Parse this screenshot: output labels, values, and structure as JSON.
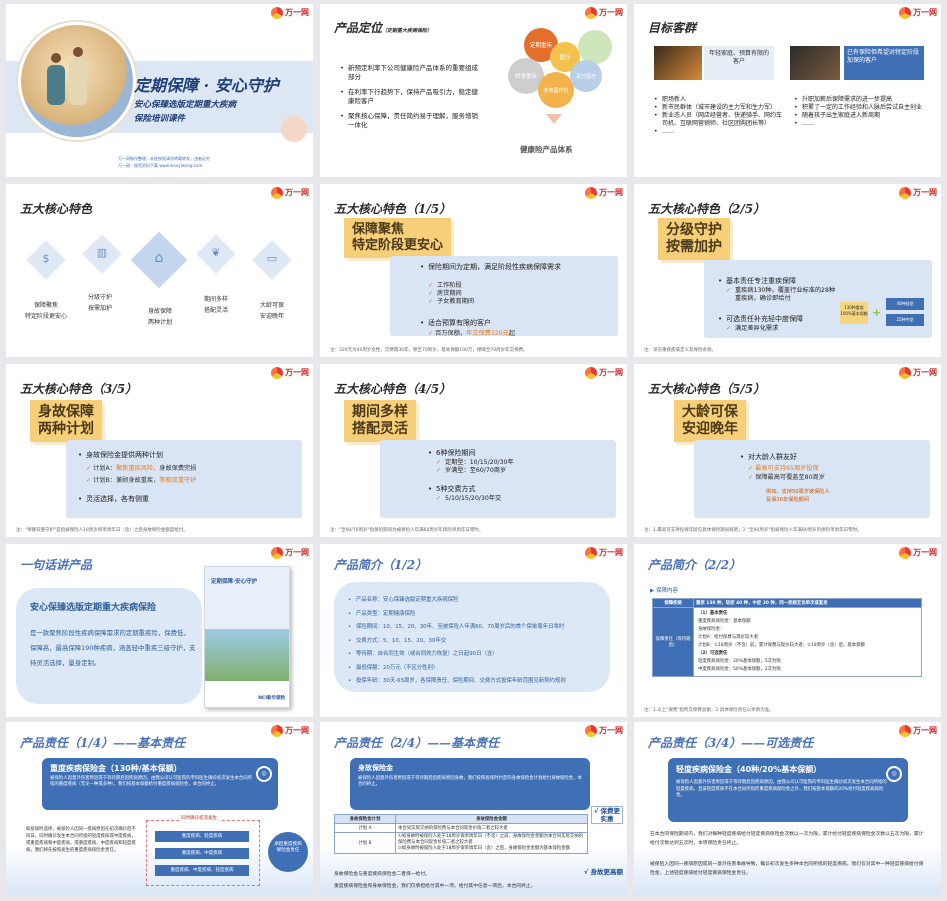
{
  "brand": {
    "logo_text": "万一网",
    "logo_sub": "WANYI.NET"
  },
  "slides": [
    {
      "id": "s1",
      "title": "定期保障 · 安心守护",
      "subtitle_line1": "安心保臻选版定期重大疾病",
      "subtitle_line2": "保险培训课件",
      "footer1": "万一网制作整理，未经授权请勿转载转发，违者必究",
      "footer2": "万一网：保险资料下载 www.wanyiwang.com"
    },
    {
      "id": "s2",
      "title": "产品定位",
      "title_note": "（定期重大疾病保险）",
      "bullets": [
        "新预定利率下公司健康险产品体系的重要组成部分",
        "在利率下行趋势下，保持产品吸引力，稳定健康险客户",
        "聚焦核心保障，责任简约易于理解，服务增销一体化"
      ],
      "circles": [
        "定期重疾",
        "终身重疾",
        "医疗",
        "重疾+",
        "各类医疗险",
        "百万医疗"
      ],
      "caption": "健康险产品体系"
    },
    {
      "id": "s3",
      "title": "目标客群",
      "card1": "年轻家庭、预算有限的客户",
      "card2": "已有保险但希望对特定阶段加保的客户",
      "col1": [
        "职场新人",
        "新市民群体（城市建设的主力军和生力军）",
        "新业态人员（网店经营者、快递骑手、网约车司机、互联网营销师、社区团购团长等）",
        "……"
      ],
      "col2": [
        "升职加薪后保障需求的进一步提高",
        "积累了一定的工作经验和人脉后尝试自主创业",
        "随着孩子出生家庭进入新周期",
        "……"
      ]
    },
    {
      "id": "s4",
      "title": "五大核心特色",
      "features": [
        "保障聚焦\n特定阶段更安心",
        "分级守护\n按需加护",
        "身故保障\n两种计划",
        "期间多样\n搭配灵活",
        "大龄可保\n安迎晚年"
      ]
    },
    {
      "id": "s5",
      "title": "五大核心特色（1/5）",
      "badge": "保障聚焦\n特定阶段更安心",
      "b1": "保险期间为定期，满足阶段性疾病保障需求",
      "b1_sub": [
        "工作阶段",
        "房贷期间",
        "子女教育期间"
      ],
      "b2": "适合预算有限的客户",
      "b2_sub_prefix": "百万保额，",
      "b2_sub_hl": "年交保费320元",
      "b2_sub_suffix": "起",
      "foot": "注：320元为40周岁女性，交费期30年，保至70周岁，基本保额100万，保障至70周岁年交保费。"
    },
    {
      "id": "s6",
      "title": "五大核心特色（2/5）",
      "badge": "分级守护\n按需加护",
      "b1": "基本责任专注重疾保障",
      "b1_sub": [
        "重疾病130种，覆盖行业标准的28种重疾病，确诊即给付"
      ],
      "b2": "可选责任补充轻中度保障",
      "b2_sub": [
        "满足差异化需求"
      ],
      "box1": "130种重疾",
      "box2": "100%基本保额",
      "box3": "40种轻症",
      "box4": "25种中症",
      "foot": "注：详见重疾疾病定义及保险条款。"
    },
    {
      "id": "s7",
      "title": "五大核心特色（3/5）",
      "badge": "身故保障\n两种计划",
      "b1": "身故保险金提供两种计划",
      "b1_sub_a_prefix": "计划A：",
      "b1_sub_a_hl": "聚焦重疾风险，",
      "b1_sub_a_suffix": "身故保费完损",
      "b1_sub_b_prefix": "计划B：兼顾身故重疾，",
      "b1_sub_b_hl": "等额双重守护",
      "b2": "灵活选择，各有侧重",
      "foot": "注：\"保额双重守护\"是指被保险人18周岁保单周年日（含）之后身故保险金额度给付。"
    },
    {
      "id": "s8",
      "title": "五大核心特色（4/5）",
      "badge": "期间多样\n搭配灵活",
      "b1": "6种保险期间",
      "b1_sub": [
        "定期型：10/15/20/30年",
        "岁满型：至60/70周岁"
      ],
      "b2": "5种交费方式",
      "b2_sub": [
        "5/10/15/20/30年交"
      ],
      "foot": "注：\"至60/70周岁\"指保险期间为被保险人年满60周岁年保险单周年日零时。"
    },
    {
      "id": "s9",
      "title": "五大核心特色（5/5）",
      "badge": "大龄可保\n安迎晚年",
      "b1": "对大龄人群友好",
      "b1_sub": [
        "最高可支持65周岁投保",
        "保障最高可覆盖至80周岁"
      ],
      "note1": "例如，支持50周岁被保险人",
      "note2": "投保30年保险期间",
      "foot": "注：1.最高可支持投保年龄见具体保险期间规则；2.\"至80周岁\"指被保险人年满80周岁的保险单周年日零时。"
    },
    {
      "id": "s10",
      "title": "一句话讲产品",
      "heading": "安心保臻选版定期重大疾病保险",
      "body": "是一款聚焦阶段性疾病保障需求的定期重疾险，保费低，保障高，最高保障190种疾病，涵盖轻中重疾三级守护，支持灵活选择，量身定制。",
      "brochure_title": "定期保障·安心守护",
      "brochure_brand": "NCI新华保险"
    },
    {
      "id": "s11",
      "title": "产品简介（1/2）",
      "items": [
        "产品名称：安心保臻选版定期重大疾病保险",
        "产品类型：定期健康保险",
        "保险期间：10、15、20、30年、至被保险人年满60、70周岁后的首个保单周年日零时",
        "交费方式：5、10、15、20、30年交",
        "等待期：自合同生效（或合同效力恢复）之日起90日（含）",
        "最低保额：20万元（不区分性别）",
        "投保年龄：30天-65周岁，各保障责任、保险期间、交费方式投保年龄范围见新契约规则"
      ]
    },
    {
      "id": "s12",
      "title": "产品简介（2/2）",
      "section": "保障内容",
      "header_label": "保障疾病",
      "header_value": "重疾 130 种，轻症 40 种，中症 20 种，同一疾病无论单次或复发",
      "left_label": "保障责任（等待期后）",
      "rows": [
        "（1）基本责任",
        "重度疾病保险金：基本保额",
        "身故保险金：",
        "计划A：给付保费与现价较大者",
        "计划B：①18周岁（不含）前，累计保费与现价较大者；②18周岁（含）后，基本保额",
        "（2）可选责任",
        "轻度疾病保险金：20%基本保额，5次为限",
        "中度疾病保险金：50%基本保额，2次为限"
      ],
      "foot": "注：1.以上\"保费\"指所交保费总额；2.具体保险责任以条款为准。"
    },
    {
      "id": "s13",
      "title": "产品责任（1/4）——基本责任",
      "box_title": "重度疾病保险金（130种/基本保额）",
      "box_text": "被保险人因意外伤害原因或于等待期后因疾病原因，由我公司认可医院的专科医生确诊初次发生本合同所指的重度疾病（无论一种或多种），我们按基本保额给付重度疾病保险金，本合同终止。",
      "left_text": "如投保时选择，被保险人因同一疾病原因在初次确诊后不同日，同时确诊发生本合同所指的轻度疾病或中度疾病，或重度疾病和中度疾病，或重度疾病、中度疾病和轻度疾病，我们将先按照发生的重度疾病保险金责任。",
      "flow_top": "同时确诊初次发生",
      "flow_items": [
        "重度疾病、轻度疾病",
        "重度疾病、中度疾病",
        "重度疾病、中度疾病、轻度疾病"
      ],
      "circle": "承担重度疾病保险金责任"
    },
    {
      "id": "s14",
      "title": "产品责任（2/4）——基本责任",
      "box_title": "身故保险金",
      "box_text": "被保险人因意外伤害原因或于等待期后因疾病原因身故，我们按照投保时约定的身故保险金计划给付身故保险金，本合同终止。",
      "tbl_head1": "身故保险金计划",
      "tbl_head2": "身故保险金金额",
      "row_a_label": "计划 A",
      "row_a_text": "本合同实际交纳的保险费与本合同现金价值二者之较大者",
      "row_b_label": "计划 B",
      "row_b_text1": "①如身故时被保险人处于18周岁保单周年日（不含）之前，身故保险金金额为本合同实际交纳的保险费与本合同现金价值二者之较大者",
      "row_b_text2": "②如身故时被保险人处于18周岁保单周年日（含）之后，身故保险金金额为基本保险金额",
      "tag1": "√ 保费更实惠",
      "tag2": "√ 身故更高额",
      "line1": "身故保险金与重度疾病保险金二者择一给付。",
      "line2": "重度疾病保险金和身故保险金，我们仅承担给付其中一项，给付其中任意一项后，本合同终止。"
    },
    {
      "id": "s15",
      "title": "产品责任（3/4）——可选责任",
      "box_title": "轻度疾病保险金（40种/20%基本保额）",
      "box_text": "被保险人因意外伤害原因或于等待期后因疾病原因，由我公司认可医院的专科医生确诊初次发生本合同所指的轻度疾病，且该轻度疾病不在本合同所指的重度疾病保险金之外，我们按基本保额的20%给付轻度疾病保险金。",
      "para1": "在本合同保险期间内，我们对每种轻度疾病给付轻度疾病保险金次数以一次为限，累计给付轻度疾病保险金次数以五次为限，累计给付次数达到五次时，本项保险责任终止。",
      "para2": "被保险人因同一疾病原因或同一意外伤害事故导致，确诊初次发生多种本合同所指的轻度疾病，我们仅对其中一种轻度疾病给付保险金，上述轻度疾病给付轻度疾病保险金责任。"
    }
  ]
}
